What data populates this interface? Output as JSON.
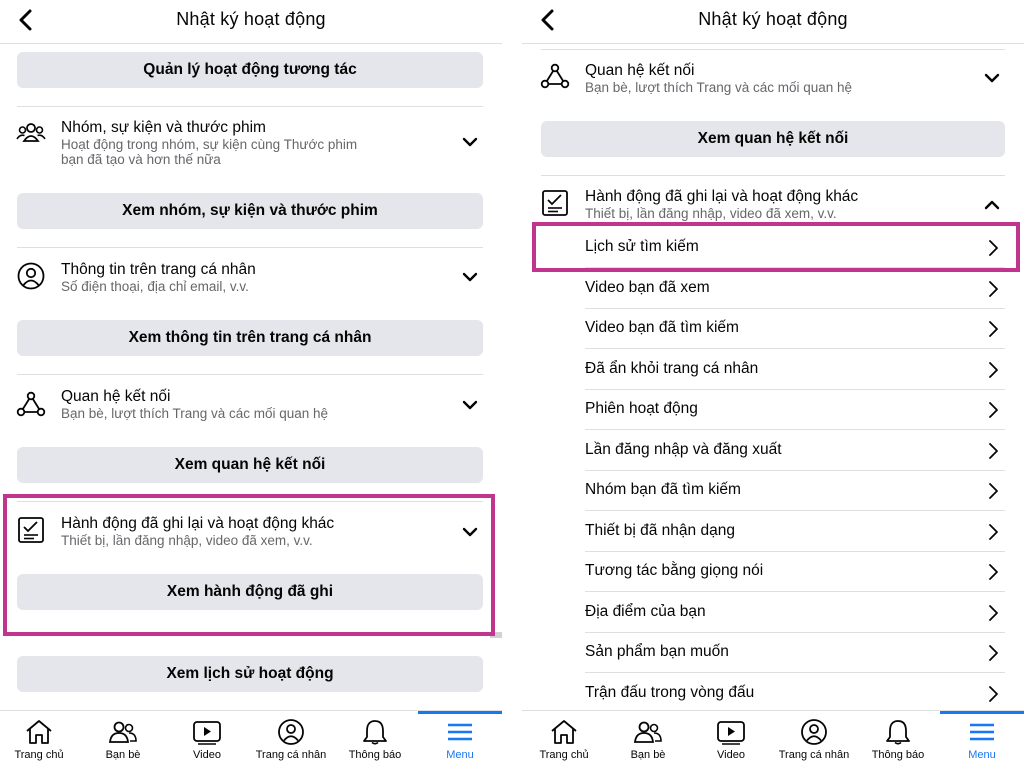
{
  "left": {
    "header": {
      "title": "Nhật ký hoạt động"
    },
    "buttons": {
      "manage_interactions": "Quản lý hoạt động tương tác",
      "view_groups": "Xem nhóm, sự kiện và thước phim",
      "view_profile": "Xem thông tin trên trang cá nhân",
      "view_connections": "Xem quan hệ kết nối",
      "view_logged_actions": "Xem hành động đã ghi",
      "view_history": "Xem lịch sử hoạt động"
    },
    "sections": [
      {
        "title": "Nhóm, sự kiện và thước phim",
        "subtitle": "Hoạt động trong nhóm, sự kiện cùng Thước phim",
        "subtitle2": "bạn đã tạo và hơn thế nữa",
        "icon": "groups-icon"
      },
      {
        "title": "Thông tin trên trang cá nhân",
        "subtitle": "Số điện thoại, địa chỉ email, v.v.",
        "icon": "profile-icon"
      },
      {
        "title": "Quan hệ kết nối",
        "subtitle": "Bạn bè, lượt thích Trang và các mối quan hệ",
        "icon": "connections-icon"
      },
      {
        "title": "Hành động đã ghi lại và hoạt động khác",
        "subtitle": "Thiết bị, lần đăng nhập, video đã xem, v.v.",
        "icon": "checklist-icon"
      }
    ]
  },
  "right": {
    "header": {
      "title": "Nhật ký hoạt động"
    },
    "sections": [
      {
        "title": "Quan hệ kết nối",
        "subtitle": "Bạn bè, lượt thích Trang và các mối quan hệ",
        "icon": "connections-icon"
      },
      {
        "title": "Hành động đã ghi lại và hoạt động khác",
        "subtitle": "Thiết bị, lần đăng nhập, video đã xem, v.v.",
        "icon": "checklist-icon"
      }
    ],
    "buttons": {
      "view_connections": "Xem quan hệ kết nối"
    },
    "items": [
      "Lịch sử tìm kiếm",
      "Video bạn đã xem",
      "Video bạn đã tìm kiếm",
      "Đã ẩn khỏi trang cá nhân",
      "Phiên hoạt động",
      "Lần đăng nhập và đăng xuất",
      "Nhóm bạn đã tìm kiếm",
      "Thiết bị đã nhận dạng",
      "Tương tác bằng giọng nói",
      "Địa điểm của bạn",
      "Sản phẩm bạn muốn",
      "Trận đấu trong vòng đấu"
    ]
  },
  "nav": {
    "items": [
      "Trang chủ",
      "Bạn bè",
      "Video",
      "Trang cá nhân",
      "Thông báo",
      "Menu"
    ],
    "active": "Menu"
  },
  "colors": {
    "highlight": "#c1358e",
    "accent": "#1877f2",
    "button_bg": "#e4e6eb",
    "subtext": "#65676b"
  }
}
